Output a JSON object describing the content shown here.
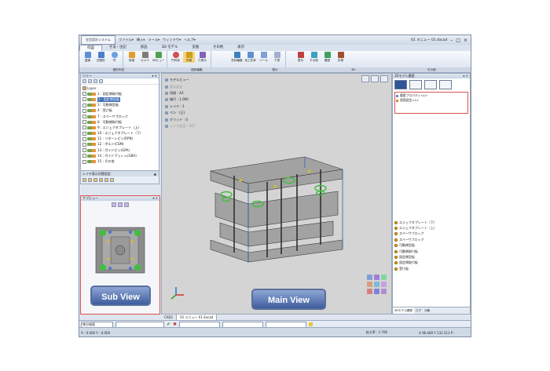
{
  "app": {
    "logo_text": "金型設計システム",
    "quick_menu": [
      "ファイル▾",
      "挿入▾",
      "ツール▾",
      "ウィンドウ▾",
      "ヘルプ▾"
    ],
    "window_title": "01 メニュー 01.4xcad"
  },
  "ribbon_tabs": [
    "作図",
    "寸法・注記",
    "部品",
    "3D モデル",
    "支援",
    "その他",
    "表示"
  ],
  "ribbon_active_tab": "作図",
  "ribbon_buttons": [
    "直線",
    "四角形",
    "円",
    "詳細",
    "カメラ",
    "3Dビュー",
    "円作成",
    "内側",
    "穴表示",
    "形状編集",
    "加工形状",
    "ツール",
    "下書",
    "表示",
    "その他",
    "確認",
    "計測"
  ],
  "ribbon_groups": [
    "図形作成",
    "図形編集",
    "表示",
    "3D",
    "その他"
  ],
  "tree_panel": {
    "title": "ツリー",
    "root": "Layer",
    "items": [
      {
        "label": "1 : 固定側取付板",
        "selected": false
      },
      {
        "label": "2 : 固定側型板",
        "selected": true
      },
      {
        "label": "3 : 可動側型板",
        "selected": false
      },
      {
        "label": "4 : 受け板",
        "selected": false
      },
      {
        "label": "7 : スペーサブロック",
        "selected": false
      },
      {
        "label": "8 : 可動側取付板",
        "selected": false
      },
      {
        "label": "9 : エジェクタプレート（上）",
        "selected": false
      },
      {
        "label": "10 : エジェクタプレート（下）",
        "selected": false
      },
      {
        "label": "11 : リターンピン(RPN)",
        "selected": false
      },
      {
        "label": "12 : ボルト(CSM)",
        "selected": false
      },
      {
        "label": "13 : ガイドピン(GPA)",
        "selected": false
      },
      {
        "label": "14 : ガイドブッシュ(GBA)",
        "selected": false
      },
      {
        "label": "15 : その他",
        "selected": false
      }
    ],
    "footer_label": "レイヤ表示切替設定"
  },
  "sub_view": {
    "title": "サブビュー",
    "label": "Sub View"
  },
  "main_view": {
    "label": "Main View",
    "info": [
      {
        "text": "モデルビュー",
        "dim": false
      },
      {
        "text": "表示設定",
        "dim": true
      },
      {
        "text": "用紙 : A2",
        "dim": false
      },
      {
        "text": "縮尺 : 1.000",
        "dim": false
      },
      {
        "text": "レイヤ : 1",
        "dim": false
      },
      {
        "text": "ペン : (正)",
        "dim": false
      },
      {
        "text": "グリッド : 0",
        "dim": false
      },
      {
        "text": "レイヤ設定 : OFF",
        "dim": true
      }
    ]
  },
  "right_panel": {
    "history": [
      "履歴プロパティ<1>",
      "透過設定<1>"
    ],
    "parts": [
      "エジェクタプレート（下）",
      "エジェクタプレート（上）",
      "スペーサブロック",
      "スペーサブロック",
      "可動側型板",
      "可動側取付板",
      "固定側型板",
      "固定側取付板",
      "受け板"
    ],
    "tabs": [
      "3Dモデル履歴",
      "ログ",
      "対象"
    ]
  },
  "doc_tabs": [
    "CAD1",
    "01 メニュー 01.4xcad"
  ],
  "cmdbar": {
    "select_value": "線分描画"
  },
  "status": {
    "left": "X : 0.000  Y : 0.000",
    "scale": "拡大率 : 1.766",
    "coords": "X 96.469 Y 131.511 P -"
  },
  "colors": {
    "accent": "#3d6fb6",
    "highlight_border": "#d9534f",
    "label_fill": "#3f5d9e",
    "part_green": "#3fbf3f"
  }
}
